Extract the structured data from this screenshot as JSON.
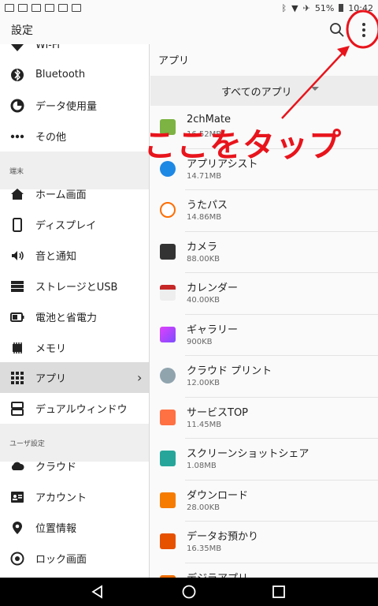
{
  "status_bar": {
    "battery": "51%",
    "time": "10:42"
  },
  "app_bar": {
    "title": "設定"
  },
  "sidebar": {
    "items": [
      {
        "label": "Wi-Fi",
        "icon": "wifi-icon"
      },
      {
        "label": "Bluetooth",
        "icon": "bluetooth-icon"
      },
      {
        "label": "データ使用量",
        "icon": "data-usage-icon"
      },
      {
        "label": "その他",
        "icon": "more-icon"
      },
      {
        "label": "ホーム画面",
        "icon": "home-icon"
      },
      {
        "label": "ディスプレイ",
        "icon": "display-icon"
      },
      {
        "label": "音と通知",
        "icon": "sound-icon"
      },
      {
        "label": "ストレージとUSB",
        "icon": "storage-icon"
      },
      {
        "label": "電池と省電力",
        "icon": "battery-icon"
      },
      {
        "label": "メモリ",
        "icon": "memory-icon"
      },
      {
        "label": "アプリ",
        "icon": "apps-icon",
        "selected": true
      },
      {
        "label": "デュアルウィンドウ",
        "icon": "dual-window-icon"
      },
      {
        "label": "クラウド",
        "icon": "cloud-icon"
      },
      {
        "label": "アカウント",
        "icon": "account-icon"
      },
      {
        "label": "位置情報",
        "icon": "location-icon"
      },
      {
        "label": "ロック画面",
        "icon": "lock-icon"
      }
    ],
    "sections": {
      "device": "端末",
      "user": "ユーザ設定"
    }
  },
  "main": {
    "title": "アプリ",
    "filter": "すべてのアプリ",
    "apps": [
      {
        "name": "2chMate",
        "size": "16.52MB",
        "color": "#7cb342"
      },
      {
        "name": "アプリアシスト",
        "size": "14.71MB",
        "color": "#1e88e5"
      },
      {
        "name": "うたパス",
        "size": "14.86MB",
        "color": "#ff6d00"
      },
      {
        "name": "カメラ",
        "size": "88.00KB",
        "color": "#333333"
      },
      {
        "name": "カレンダー",
        "size": "40.00KB",
        "color": "#c62828"
      },
      {
        "name": "ギャラリー",
        "size": "900KB",
        "color": "#e040fb"
      },
      {
        "name": "クラウド プリント",
        "size": "12.00KB",
        "color": "#90a4ae"
      },
      {
        "name": "サービスTOP",
        "size": "11.45MB",
        "color": "#ff7043"
      },
      {
        "name": "スクリーンショットシェア",
        "size": "1.08MB",
        "color": "#26a69a"
      },
      {
        "name": "ダウンロード",
        "size": "28.00KB",
        "color": "#f57c00"
      },
      {
        "name": "データお預かり",
        "size": "16.35MB",
        "color": "#e65100"
      },
      {
        "name": "デジラアプリ",
        "size": "",
        "color": "#ef6c00"
      }
    ]
  },
  "annotation": {
    "text": "ここをタップ",
    "color": "#e8141c"
  }
}
